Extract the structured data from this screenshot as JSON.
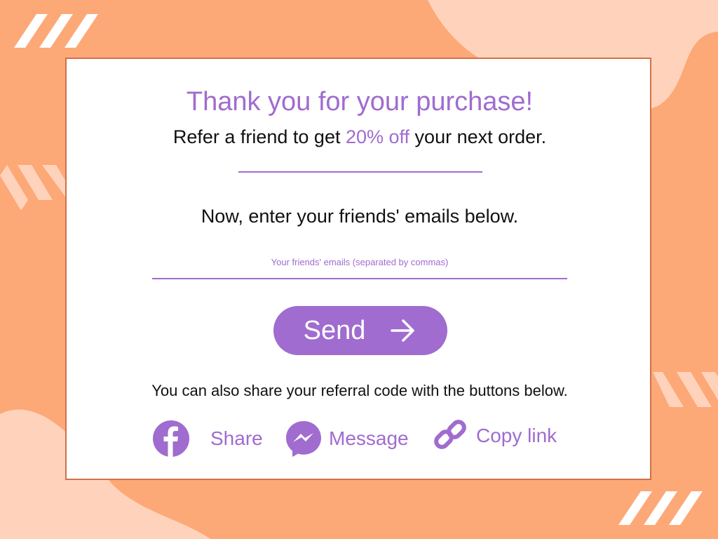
{
  "colors": {
    "accent": "#a06ccf",
    "background": "#fda877",
    "background_light": "#ffd3bb",
    "card_border": "#d0714a"
  },
  "header": {
    "title": "Thank you for your purchase!",
    "refer_prefix": "Refer a friend to get ",
    "refer_highlight": "20% off",
    "refer_suffix": " your next order."
  },
  "form": {
    "prompt": "Now, enter your friends' emails below.",
    "email_placeholder": "Your friends' emails (separated by commas)",
    "send_label": "Send",
    "send_icon": "arrow-right-icon"
  },
  "share": {
    "note": "You can also share your referral code with the buttons below.",
    "items": [
      {
        "label": "Share",
        "icon": "facebook-icon"
      },
      {
        "label": "Message",
        "icon": "messenger-icon"
      },
      {
        "label": "Copy link",
        "icon": "link-icon"
      }
    ]
  }
}
